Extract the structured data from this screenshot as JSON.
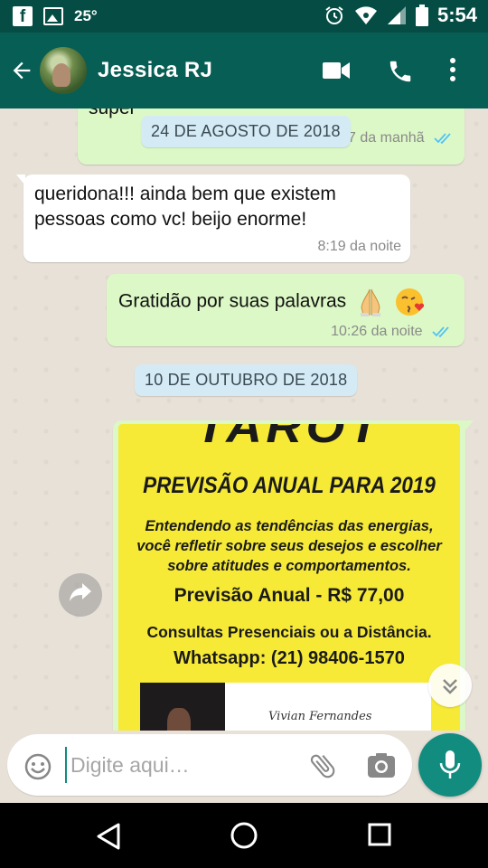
{
  "status_bar": {
    "temperature": "25°",
    "time": "5:54",
    "icons": [
      "facebook-icon",
      "image-icon",
      "alarm-icon",
      "wifi-icon",
      "signal-icon",
      "battery-icon"
    ]
  },
  "app_bar": {
    "contact_name": "Jessica RJ",
    "icons": [
      "back-arrow-icon",
      "video-call-icon",
      "phone-icon",
      "more-vert-icon"
    ]
  },
  "chat": {
    "messages": [
      {
        "direction": "out",
        "text": "super",
        "time": "10:37 da manhã",
        "ticks": "read"
      },
      {
        "direction": "in",
        "text": "queridona!!! ainda bem que existem pessoas como vc! beijo enorme!",
        "time": "8:19 da noite"
      },
      {
        "direction": "out",
        "text": "Gratidão por suas palavras",
        "emoji": [
          "folded-hands-emoji",
          "kiss-emoji"
        ],
        "time": "10:26 da noite",
        "ticks": "read"
      }
    ],
    "date_chips": [
      "24 DE AGOSTO DE 2018",
      "10 DE OUTUBRO DE 2018"
    ],
    "image_message": {
      "title": "TAROT",
      "subtitle": "PREVISÃO ANUAL PARA 2019",
      "desc_1": "Entendendo as tendências das energias,",
      "desc_2": "você refletir sobre seus desejos e escolher",
      "desc_3": "sobre atitudes e comportamentos.",
      "price": "Previsão Anual - R$ 77,00",
      "consult": "Consultas Presenciais ou a Distância.",
      "whatsapp": "Whatsapp: (21) 98406-1570",
      "signature": "Vivian Fernandes",
      "background_color": "#f6ea37"
    }
  },
  "input_bar": {
    "placeholder": "Digite aqui…",
    "value": ""
  },
  "colors": {
    "header": "#075e54",
    "status_bar": "#054d44",
    "outgoing_bubble": "#dcf8c6",
    "incoming_bubble": "#ffffff",
    "accent": "#128c7e",
    "read_ticks": "#4fc3f7"
  }
}
